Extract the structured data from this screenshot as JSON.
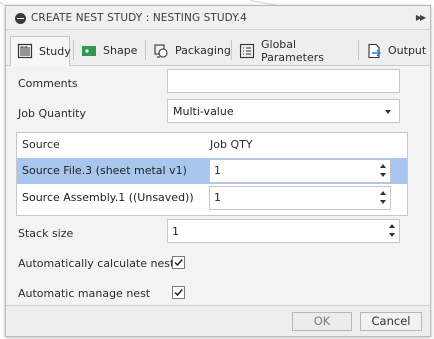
{
  "dialog": {
    "title": "CREATE NEST STUDY : NESTING STUDY.4",
    "expand_glyph": "▶▶"
  },
  "tabs": [
    {
      "label": "Study",
      "icon": "study-icon",
      "active": true
    },
    {
      "label": "Shape",
      "icon": "shape-icon",
      "active": false
    },
    {
      "label": "Packaging",
      "icon": "packaging-icon",
      "active": false
    },
    {
      "label": "Global Parameters",
      "icon": "list-icon",
      "active": false
    },
    {
      "label": "Output",
      "icon": "output-icon",
      "active": false
    }
  ],
  "form": {
    "comments_label": "Comments",
    "comments_value": "",
    "job_quantity_label": "Job Quantity",
    "job_quantity_value": "Multi-value",
    "stack_size_label": "Stack size",
    "stack_size_value": "1",
    "auto_calc_label": "Automatically calculate nest",
    "auto_calc_checked": true,
    "auto_manage_label": "Automatic manage nest",
    "auto_manage_checked": true
  },
  "table": {
    "columns": [
      "Source",
      "Job QTY"
    ],
    "rows": [
      {
        "source": "Source File.3 (sheet metal v1)",
        "qty": "1",
        "selected": true
      },
      {
        "source": "Source Assembly.1 ((Unsaved))",
        "qty": "1",
        "selected": false
      }
    ]
  },
  "footer": {
    "ok_label": "OK",
    "cancel_label": "Cancel"
  },
  "colors": {
    "selection": "#a9c7ee",
    "accent_green": "#2e9a4c",
    "accent_blue": "#2b7fd1"
  }
}
